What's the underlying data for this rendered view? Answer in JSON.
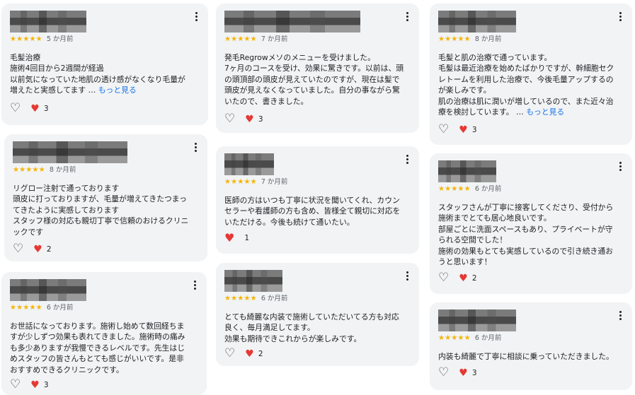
{
  "reviews": [
    {
      "stars": "★★★★★",
      "time": "5 か月前",
      "text": "毛髪治療\n施術4回目から2週間が経過\n以前気になっていた地肌の透け感がなくなり毛量が\n増えたと実感してます … ",
      "more": "もっと見る",
      "likes": "3"
    },
    {
      "stars": "★★★★★",
      "time": "8 か月前",
      "text": "リグロー注射で通っております\n頭皮に打っておりますが、毛量が増えてきたつまっ\nてきたように実感しております\nスタッフ様の対応も親切丁寧で信頼のおけるクリニ\nックです",
      "more": "",
      "likes": "2"
    },
    {
      "stars": "★★★★★",
      "time": "6 か月前",
      "text": "お世話になっております。施術し始めて数回経ちま\nすが少しずつ効果も表れてきました。施術時の痛み\nも多少ありますが我慢できるレベルです。先生はじ\nめスタッフの皆さんもとても感じがいいです。是非\nおすすめできるクリニックです。",
      "more": "",
      "likes": "3"
    },
    {
      "stars": "★★★★★",
      "time": "7 か月前",
      "text": "発毛Regrowメソのメニューを受けました。\n7ヶ月のコースを受け、効果に驚きです。以前は、頭\nの頭頂部の頭皮が見えていたのですが、現在は髪で\n頭皮が見えなくなっていました。自分の事ながら驚\nいたので、書きました。",
      "more": "",
      "likes": "3"
    },
    {
      "stars": "★★★★★",
      "time": "7 か月前",
      "text": "医師の方はいつも丁寧に状況を聞いてくれ、カウン\nセラーや看護師の方も含め、皆様全て親切に対応を\nいただける。今後も続けて通いたい。",
      "more": "",
      "likes": "1"
    },
    {
      "stars": "★★★★★",
      "time": "6 か月前",
      "text": "とても綺麗な内装で施術していただいてる方も対応\n良く、毎月満足してます。\n効果も期待できこれからが楽しみです。",
      "more": "",
      "likes": "2"
    },
    {
      "stars": "★★★★★",
      "time": "8 か月前",
      "text": "毛髪と肌の治療で通っています。\n毛髪は最近治療を始めたばかりですが、幹細胞セク\nレトームを利用した治療で、今後毛量アップするの\nが楽しみです。\n肌の治療は肌に潤いが増しているので、また近々治\n療を検討しています。 … ",
      "more": "もっと見る",
      "likes": "3"
    },
    {
      "stars": "★★★★★",
      "time": "6 か月前",
      "text": "スタッフさんが丁寧に接客してくださり、受付から\n施術までとても居心地良いです。\n部屋ごとに洗面スペースもあり、プライベートが守\nられる空間でした！\n施術の効果もとても実感しているので引き続き通お\nうと思います！",
      "more": "",
      "likes": "2"
    },
    {
      "stars": "★★★★★",
      "time": "6 か月前",
      "text": "内装も綺麗で丁寧に相談に乗っていただきました。",
      "more": "",
      "likes": "3"
    }
  ],
  "colors": {
    "card": "#f1f3f4",
    "star": "#f6b400",
    "heart": "#e53935",
    "link": "#1a73e8"
  },
  "icons": {
    "like": "heart-outline-icon",
    "reaction": "heart-icon",
    "menu": "more-vert-icon"
  }
}
